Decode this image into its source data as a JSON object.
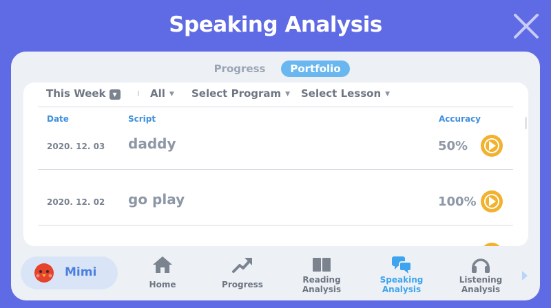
{
  "window": {
    "title": "Speaking Analysis"
  },
  "tabs": [
    {
      "label": "Progress",
      "active": false
    },
    {
      "label": "Portfolio",
      "active": true
    }
  ],
  "filters": {
    "period": "This Week",
    "scope": "All",
    "program": "Select Program",
    "lesson": "Select Lesson"
  },
  "table": {
    "columns": {
      "date": "Date",
      "script": "Script",
      "accuracy": "Accuracy"
    },
    "rows": [
      {
        "date": "2020. 12. 03",
        "script": "daddy",
        "accuracy": "50%"
      },
      {
        "date": "2020. 12. 02",
        "script": "go play",
        "accuracy": "100%"
      }
    ]
  },
  "profile": {
    "name": "Mimi"
  },
  "nav": {
    "home": "Home",
    "progress": "Progress",
    "reading_1": "Reading",
    "reading_2": "Analysis",
    "speaking_1": "Speaking",
    "speaking_2": "Analysis",
    "listening_1": "Listening",
    "listening_2": "Analysis"
  },
  "icons": {
    "close": "close-icon",
    "play": "play-icon",
    "home": "home-icon",
    "progress": "trend-arrow-icon",
    "reading": "book-icon",
    "speaking": "speech-bubbles-icon",
    "listening": "headphones-icon",
    "next": "chevron-right-icon"
  },
  "colors": {
    "background": "#5f6ae5",
    "accent": "#6ab7ef",
    "active_nav": "#3ea4ee",
    "play": "#f2b12e",
    "header_text": "#3e8fde",
    "profile": "#4a7fe0"
  }
}
